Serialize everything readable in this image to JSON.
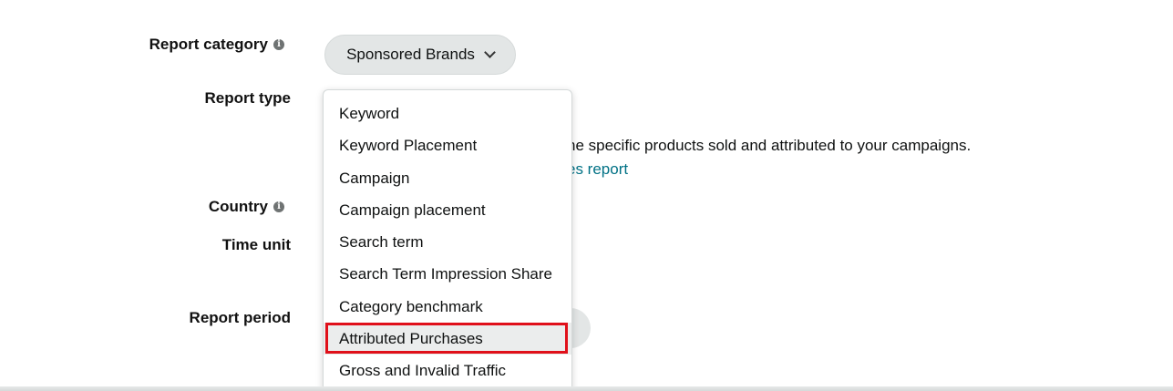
{
  "form": {
    "report_category_label": "Report category",
    "report_type_label": "Report type",
    "country_label": "Country",
    "time_unit_label": "Time unit",
    "report_period_label": "Report period",
    "info_glyph": "i"
  },
  "category_dropdown": {
    "selected": "Sponsored Brands",
    "icon": "chevron-down-icon"
  },
  "description": {
    "text": "he specific products sold and attributed to your campaigns.",
    "link": "es report"
  },
  "report_type_menu": {
    "items": [
      {
        "label": "Keyword"
      },
      {
        "label": "Keyword Placement"
      },
      {
        "label": "Campaign"
      },
      {
        "label": "Campaign placement"
      },
      {
        "label": "Search term"
      },
      {
        "label": "Search Term Impression Share"
      },
      {
        "label": "Category benchmark"
      },
      {
        "label": "Attributed Purchases",
        "highlighted": true
      },
      {
        "label": "Gross and Invalid Traffic"
      }
    ]
  },
  "colors": {
    "highlight_border": "#e0101a",
    "link": "#007185",
    "pill_bg": "#e3e6e6"
  }
}
